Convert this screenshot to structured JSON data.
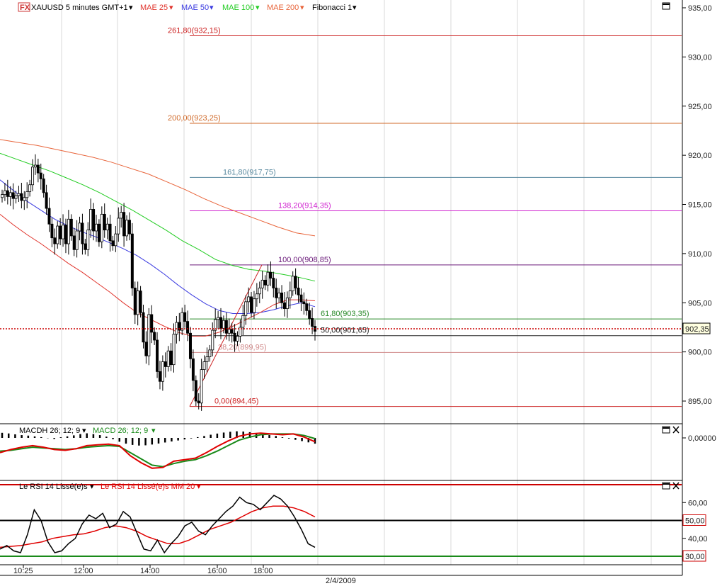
{
  "header": {
    "fx_badge": "FX",
    "symbol": "XAUUSD 5 minutes GMT+1",
    "mae25": "MAE 25",
    "mae50": "MAE 50",
    "mae100": "MAE 100",
    "mae200": "MAE 200",
    "fibonacci": "Fibonacci 1"
  },
  "macd_header": {
    "macdh": "MACDH 26; 12; 9",
    "macd": "MACD 26; 12; 9"
  },
  "rsi_header": {
    "rsi": "Le RSI 14 Lissé(e)s",
    "rsi_ma": "Le RSI 14 Lissé(e)s MM 20"
  },
  "date_label": "2/4/2009",
  "colors": {
    "candle_up": "#ffffff",
    "candle_down": "#000000",
    "mae25": "#e0342c",
    "mae50": "#3a3ae0",
    "mae100": "#22cc22",
    "mae200": "#e8643a",
    "current_price": "#cc0000",
    "macd_signal": "#1a8a1a",
    "macd_line": "#e00000",
    "rsi_line": "#000000",
    "rsi_ma": "#e00000",
    "rsi_upper": "#cc0000",
    "rsi_lower": "#1a8a1a",
    "fib_261": "#cc2222",
    "fib_200": "#d06a2a",
    "fib_161": "#5a8aa0",
    "fib_138": "#d024d0",
    "fib_100": "#6a1a7a",
    "fib_61": "#2a8a2a",
    "fib_50": "#222222",
    "fib_38": "#d08a8a",
    "fib_0": "#cc2222"
  },
  "chart_data": [
    {
      "type": "candlestick",
      "title": "XAUUSD 5 minutes GMT+1",
      "x_tick_labels": [
        "10:25",
        "12:00",
        "14:00",
        "16:00",
        "18:00"
      ],
      "y_tick_labels": [
        "935,00",
        "930,00",
        "925,00",
        "920,00",
        "915,00",
        "910,00",
        "905,00",
        "900,00",
        "895,00"
      ],
      "ylim": [
        892.5,
        936.0
      ],
      "current_price": 902.35,
      "current_price_label": "902,35",
      "fibonacci_levels": [
        {
          "ratio": 261.8,
          "price": 932.15,
          "label": "261,80(932,15)",
          "color_key": "fib_261"
        },
        {
          "ratio": 200.0,
          "price": 923.25,
          "label": "200,00(923,25)",
          "color_key": "fib_200"
        },
        {
          "ratio": 161.8,
          "price": 917.75,
          "label": "161,80(917,75)",
          "color_key": "fib_161"
        },
        {
          "ratio": 138.2,
          "price": 914.35,
          "label": "138,20(914,35)",
          "color_key": "fib_138"
        },
        {
          "ratio": 100.0,
          "price": 908.85,
          "label": "100,00(908,85)",
          "color_key": "fib_100"
        },
        {
          "ratio": 61.8,
          "price": 903.35,
          "label": "61,80(903,35)",
          "color_key": "fib_61"
        },
        {
          "ratio": 50.0,
          "price": 901.65,
          "label": "50,00(901,65)",
          "color_key": "fib_50"
        },
        {
          "ratio": 38.2,
          "price": 899.95,
          "label": "38,20(899,95)",
          "color_key": "fib_38"
        },
        {
          "ratio": 0.0,
          "price": 894.45,
          "label": "0,00(894,45)",
          "color_key": "fib_0"
        }
      ],
      "candles_close": [
        916.0,
        916.4,
        915.8,
        916.2,
        915.6,
        915.9,
        916.1,
        915.4,
        915.7,
        916.3,
        917.0,
        918.8,
        919.0,
        918.2,
        917.6,
        916.2,
        914.6,
        913.0,
        911.6,
        911.0,
        912.8,
        911.5,
        912.9,
        911.0,
        913.5,
        911.8,
        910.4,
        912.3,
        913.1,
        911.0,
        910.4,
        912.4,
        914.5,
        912.3,
        913.0,
        911.2,
        914.0,
        912.4,
        913.0,
        911.3,
        910.8,
        912.0,
        913.6,
        914.2,
        911.8,
        913.4,
        912.0,
        906.5,
        903.8,
        906.2,
        904.0,
        901.0,
        899.6,
        903.8,
        902.0,
        901.2,
        898.0,
        897.0,
        899.0,
        898.5,
        900.1,
        898.7,
        901.8,
        903.0,
        902.2,
        904.0,
        903.1,
        901.9,
        899.3,
        897.1,
        895.0,
        894.8,
        898.2,
        899.0,
        899.5,
        900.2,
        902.2,
        903.3,
        903.5,
        902.4,
        903.2,
        901.9,
        902.3,
        901.9,
        901.1,
        901.6,
        902.5,
        903.7,
        905.1,
        905.6,
        904.0,
        905.4,
        905.9,
        906.5,
        907.3,
        906.8,
        908.1,
        907.5,
        906.5,
        905.5,
        906.0,
        905.0,
        904.4,
        905.5,
        906.2,
        907.7,
        906.5,
        905.8,
        905.1,
        904.9,
        904.2,
        903.4,
        902.6,
        902.1
      ],
      "mae25": [
        914.0,
        912.9,
        911.9,
        911.0,
        910.0,
        909.0,
        908.1,
        907.1,
        906.1,
        905.0,
        904.0,
        903.3,
        902.6,
        902.0,
        901.6,
        901.6,
        902.0,
        902.6,
        903.3,
        904.0,
        904.8,
        905.3,
        905.3,
        905.2
      ],
      "mae50": [
        917.5,
        916.4,
        915.3,
        914.4,
        913.5,
        912.8,
        912.2,
        911.7,
        911.1,
        910.5,
        909.8,
        908.9,
        907.9,
        906.8,
        905.8,
        904.9,
        904.2,
        903.9,
        903.9,
        904.0,
        904.3,
        904.7,
        905.0,
        904.6
      ],
      "mae100": [
        920.2,
        919.6,
        919.0,
        918.4,
        917.7,
        917.0,
        916.2,
        915.3,
        914.4,
        913.4,
        912.4,
        911.3,
        910.4,
        909.4,
        908.8,
        908.4,
        908.2,
        907.9,
        907.6,
        907.2
      ],
      "mae200": [
        921.6,
        921.3,
        921.0,
        920.6,
        920.2,
        919.8,
        919.3,
        918.7,
        918.1,
        917.3,
        916.5,
        915.6,
        914.8,
        914.1,
        913.4,
        912.7,
        912.1,
        911.8
      ]
    },
    {
      "type": "histogram+line",
      "title": "MACD 26; 12; 9",
      "y_tick_labels": [
        "0,00000"
      ],
      "macd_line": [
        -0.8,
        -0.4,
        -0.1,
        0.1,
        -0.1,
        -0.4,
        -0.5,
        -0.3,
        0.1,
        0.2,
        0.3,
        0.1,
        -1.2,
        -2.1,
        -2.8,
        -2.7,
        -1.9,
        -1.7,
        -1.5,
        -0.8,
        0.0,
        0.7,
        1.3,
        1.6,
        1.7,
        1.6,
        1.5,
        1.6,
        1.2,
        0.6
      ],
      "signal_line": [
        -0.6,
        -0.5,
        -0.3,
        -0.1,
        -0.2,
        -0.3,
        -0.4,
        -0.3,
        -0.1,
        0.0,
        0.1,
        0.0,
        -0.8,
        -1.6,
        -2.4,
        -2.6,
        -2.2,
        -1.9,
        -1.7,
        -1.2,
        -0.6,
        0.1,
        0.8,
        1.2,
        1.5,
        1.6,
        1.6,
        1.6,
        1.4,
        1.0
      ],
      "histogram": [
        0.4,
        0.35,
        0.28,
        0.22,
        0.18,
        0.12,
        0.06,
        -0.02,
        -0.08,
        0.05,
        0.12,
        0.2,
        0.3,
        0.36,
        0.3,
        0.22,
        0.1,
        -0.1,
        -0.3,
        -0.45,
        -0.55,
        -0.6,
        -0.58,
        -0.52,
        -0.44,
        -0.36,
        -0.28,
        -0.2,
        -0.12,
        -0.04,
        0.06,
        0.15,
        0.25,
        0.34,
        0.42,
        0.48,
        0.52,
        0.5,
        0.45,
        0.38,
        0.3,
        0.22,
        0.15,
        0.05,
        -0.05,
        -0.15,
        -0.25,
        -0.35,
        -0.45
      ]
    },
    {
      "type": "line",
      "title": "Le RSI 14 Lissé(e)s",
      "y_tick_labels": [
        "60,00",
        "40,00"
      ],
      "ylim": [
        25,
        72
      ],
      "upper_band": 70,
      "lower_band": 30,
      "mid_band": 50,
      "upper_band_label": "50,00",
      "lower_band_label": "30,00",
      "rsi": [
        34,
        36,
        33,
        32,
        42,
        56,
        50,
        38,
        32,
        33,
        37,
        40,
        48,
        53,
        51,
        54,
        46,
        48,
        55,
        52,
        43,
        34,
        33,
        39,
        32,
        37,
        41,
        47,
        49,
        44,
        42,
        47,
        51,
        55,
        58,
        63,
        60,
        59,
        56,
        60,
        64,
        62,
        58,
        52,
        45,
        37,
        35
      ],
      "rsi_ma": [
        35,
        35.5,
        36,
        37,
        38,
        40,
        41,
        42,
        42.5,
        44,
        46,
        47,
        46,
        44,
        41,
        39,
        37,
        37,
        39,
        42,
        45,
        47,
        49,
        52,
        55,
        57,
        58,
        58,
        57,
        55,
        52
      ]
    }
  ]
}
